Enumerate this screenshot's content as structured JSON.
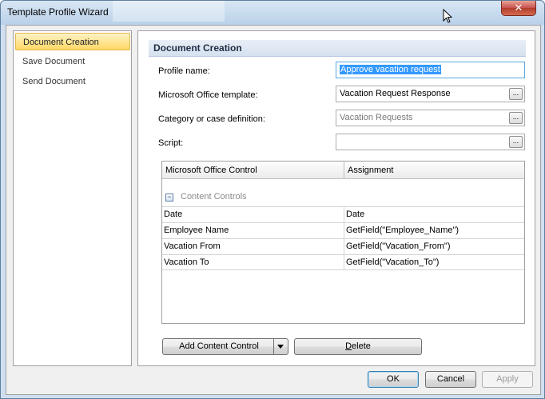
{
  "window": {
    "title": "Template Profile Wizard",
    "close_glyph": "✕"
  },
  "nav": {
    "items": [
      {
        "label": "Document Creation",
        "selected": true
      },
      {
        "label": "Save Document",
        "selected": false
      },
      {
        "label": "Send Document",
        "selected": false
      }
    ]
  },
  "section": {
    "title": "Document Creation"
  },
  "form": {
    "profile_name": {
      "label": "Profile name:",
      "value": "Approve vacation request"
    },
    "office_template": {
      "label": "Microsoft Office template:",
      "value": "Vacation Request Response",
      "browse": "..."
    },
    "category": {
      "label": "Category or case definition:",
      "value": "Vacation Requests",
      "browse": "..."
    },
    "script": {
      "label": "Script:",
      "value": "",
      "browse": "..."
    }
  },
  "grid": {
    "columns": [
      "Microsoft Office Control",
      "Assignment"
    ],
    "group": {
      "label": "Content Controls",
      "expander": "−"
    },
    "rows": [
      [
        "Date",
        "Date"
      ],
      [
        "Employee Name",
        "GetField(\"Employee_Name\")"
      ],
      [
        "Vacation From",
        "GetField(\"Vacation_From\")"
      ],
      [
        "Vacation To",
        "GetField(\"Vacation_To\")"
      ]
    ]
  },
  "buttons": {
    "add_content_control": "Add Content Control",
    "delete_prefix": "D",
    "delete_rest": "elete",
    "ok": "OK",
    "cancel": "Cancel",
    "apply": "Apply"
  },
  "icons": {
    "close": "close-icon",
    "cursor": "mouse-cursor-icon",
    "expander": "collapse-icon",
    "dropdown": "chevron-down-icon"
  }
}
